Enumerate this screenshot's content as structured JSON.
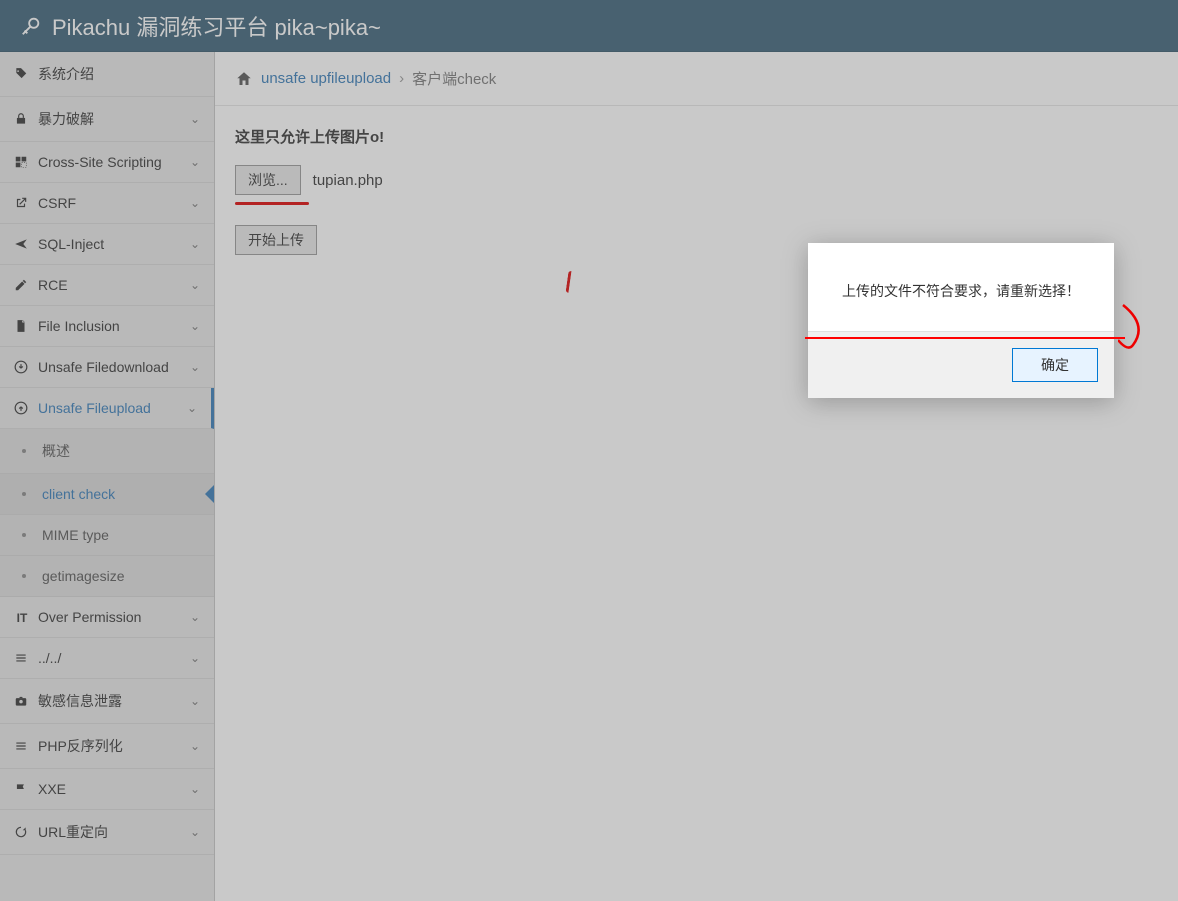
{
  "header": {
    "title": "Pikachu 漏洞练习平台 pika~pika~"
  },
  "sidebar": {
    "items": [
      {
        "icon": "tag",
        "label": "系统介绍",
        "chevron": false
      },
      {
        "icon": "lock",
        "label": "暴力破解",
        "chevron": true
      },
      {
        "icon": "xss",
        "label": "Cross-Site Scripting",
        "chevron": true
      },
      {
        "icon": "share",
        "label": "CSRF",
        "chevron": true
      },
      {
        "icon": "plane",
        "label": "SQL-Inject",
        "chevron": true
      },
      {
        "icon": "pencil",
        "label": "RCE",
        "chevron": true
      },
      {
        "icon": "file",
        "label": "File Inclusion",
        "chevron": true
      },
      {
        "icon": "download",
        "label": "Unsafe Filedownload",
        "chevron": true
      },
      {
        "icon": "upload",
        "label": "Unsafe Fileupload",
        "chevron": true,
        "active": true
      },
      {
        "icon": "it",
        "label": "Over Permission",
        "chevron": true
      },
      {
        "icon": "list",
        "label": "../../",
        "chevron": true
      },
      {
        "icon": "camera",
        "label": "敏感信息泄露",
        "chevron": true
      },
      {
        "icon": "list",
        "label": "PHP反序列化",
        "chevron": true
      },
      {
        "icon": "flag",
        "label": "XXE",
        "chevron": true
      },
      {
        "icon": "refresh",
        "label": "URL重定向",
        "chevron": true
      }
    ],
    "sub": {
      "items": [
        {
          "label": "概述"
        },
        {
          "label": "client check",
          "active": true
        },
        {
          "label": "MIME type"
        },
        {
          "label": "getimagesize"
        }
      ]
    }
  },
  "breadcrumb": {
    "text1": "unsafe upfileupload",
    "text2": "客户端check"
  },
  "content": {
    "heading": "这里只允许上传图片o!",
    "browse_label": "浏览...",
    "filename": "tupian.php",
    "upload_label": "开始上传"
  },
  "alert": {
    "message": "上传的文件不符合要求，请重新选择！",
    "ok": "确定"
  },
  "icons": {
    "tag": "🏷",
    "lock": "🔒",
    "xss": "⬚",
    "share": "↗",
    "plane": "✈",
    "pencil": "✎",
    "file": "📄",
    "download": "⊕",
    "upload": "⊕",
    "it": "IT",
    "list": "≡",
    "camera": "📷",
    "flag": "⚑",
    "refresh": "↻"
  }
}
